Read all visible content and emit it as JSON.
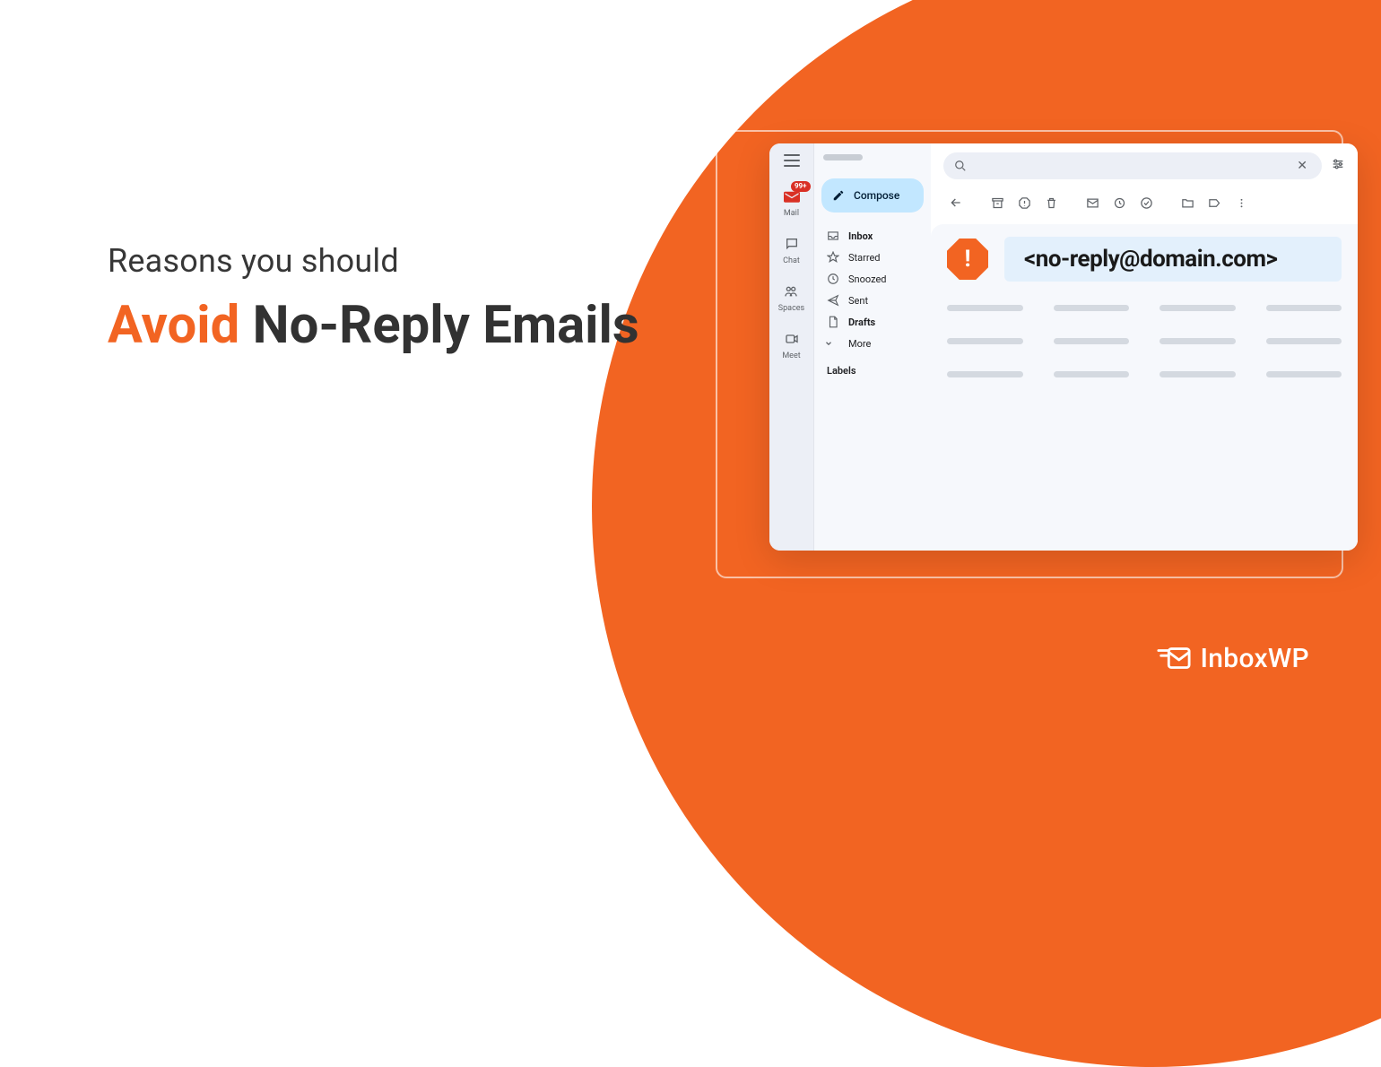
{
  "headline": {
    "line1": "Reasons you should",
    "accent": "Avoid",
    "rest": " No-Reply Emails"
  },
  "app_rail": {
    "badge": "99+",
    "items": [
      {
        "label": "Mail"
      },
      {
        "label": "Chat"
      },
      {
        "label": "Spaces"
      },
      {
        "label": "Meet"
      }
    ]
  },
  "sidebar": {
    "compose": "Compose",
    "items": [
      {
        "label": "Inbox",
        "bold": true
      },
      {
        "label": "Starred",
        "bold": false
      },
      {
        "label": "Snoozed",
        "bold": false
      },
      {
        "label": "Sent",
        "bold": false
      },
      {
        "label": "Drafts",
        "bold": true
      },
      {
        "label": "More",
        "bold": false
      }
    ],
    "labels_title": "Labels"
  },
  "search": {
    "placeholder": ""
  },
  "sender": {
    "address": "<no-reply@domain.com>"
  },
  "brand": {
    "name": "InboxWP"
  },
  "colors": {
    "accent": "#F26422",
    "pill": "#E3F0FC",
    "badge": "#d93025"
  }
}
